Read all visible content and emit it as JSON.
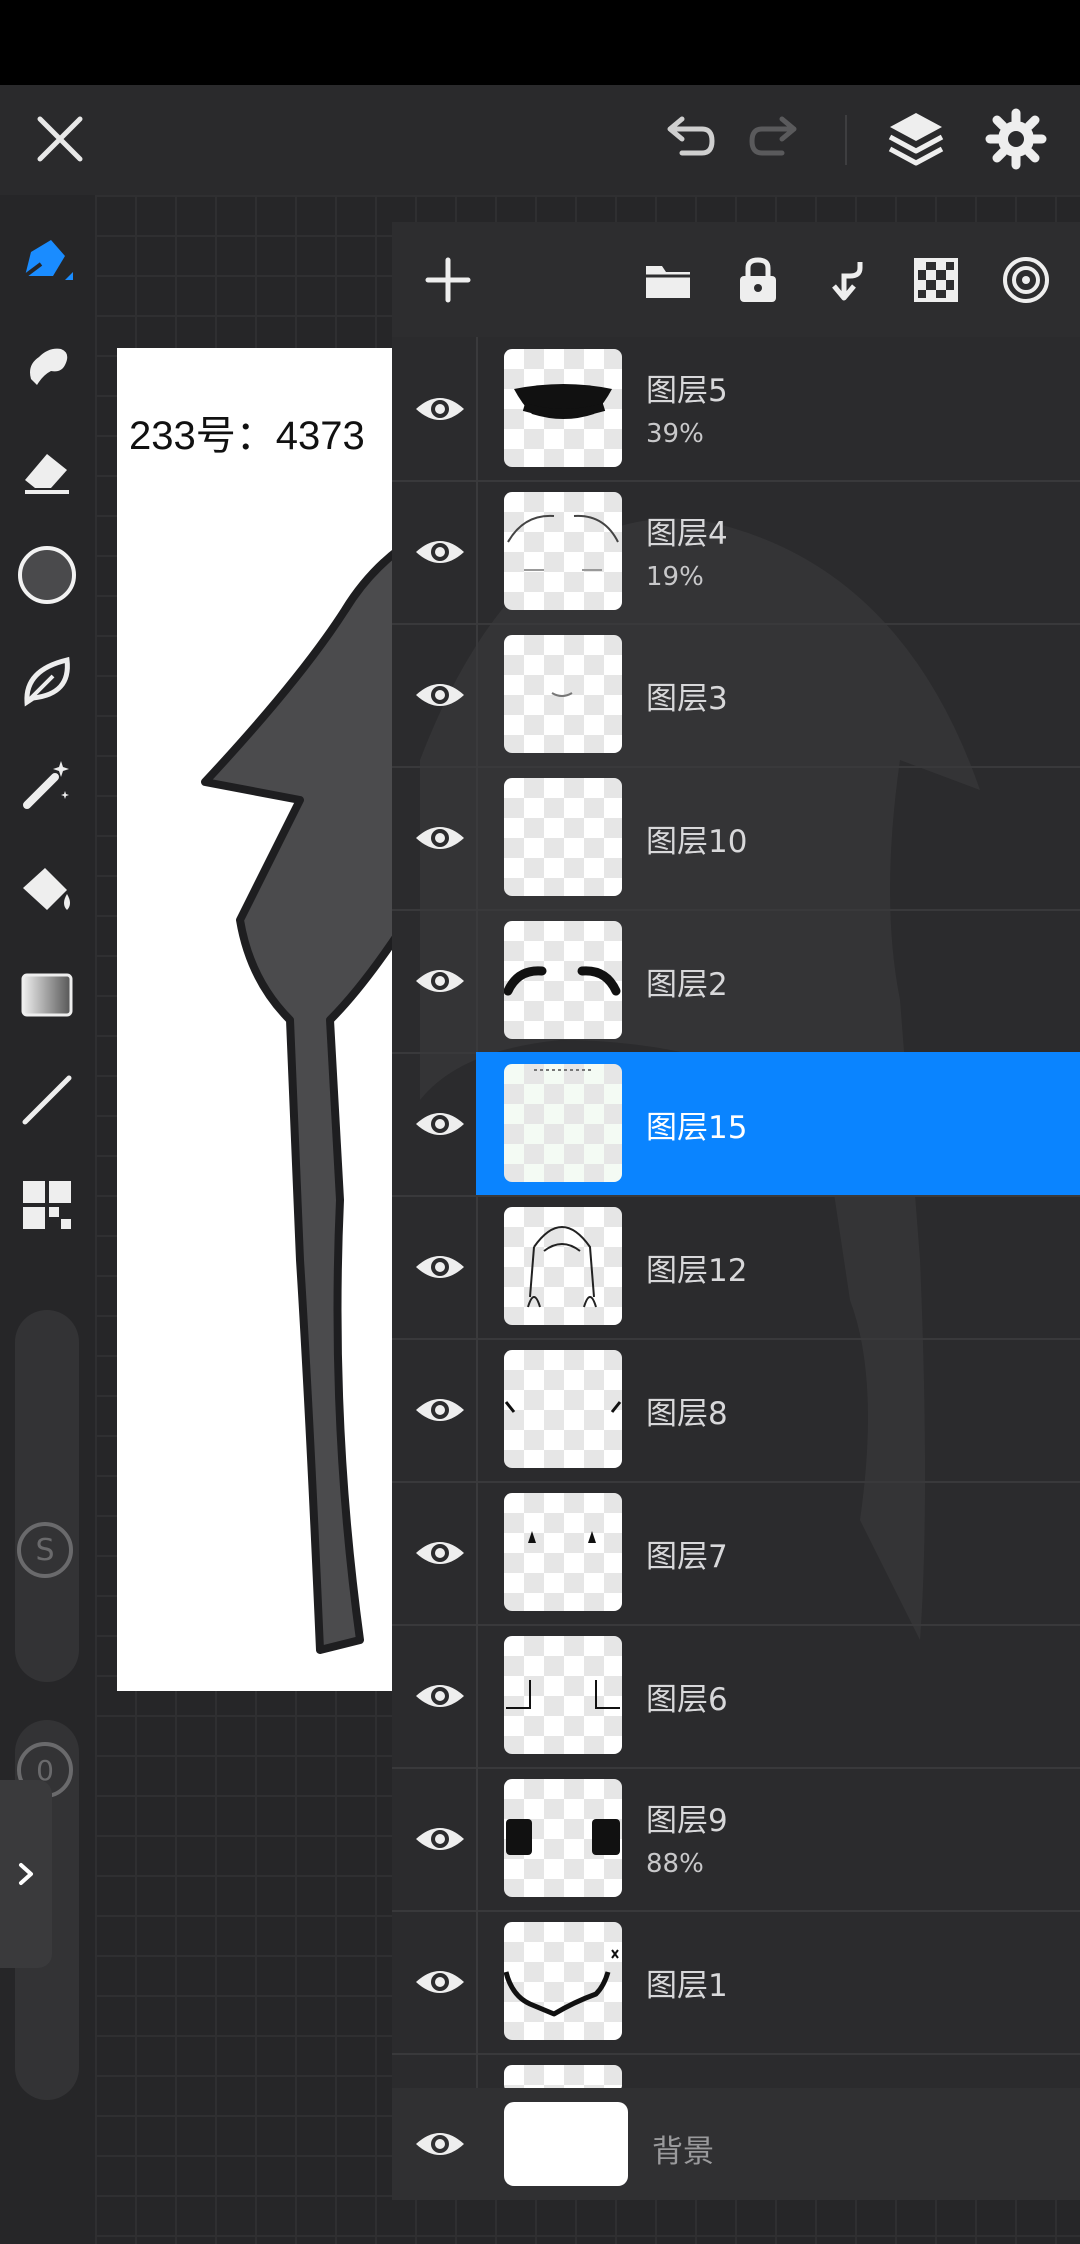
{
  "topbar": {
    "close_icon": "close-icon",
    "undo_icon": "undo-icon",
    "redo_icon": "redo-icon",
    "layers_icon": "layers-icon",
    "settings_icon": "gear-icon"
  },
  "toolbar": {
    "tools": [
      "pen-tool-icon",
      "smudge-icon",
      "eraser-icon",
      "color-swatch",
      "leaf-brush-icon",
      "magic-wand-icon",
      "fill-bucket-icon",
      "gradient-icon",
      "line-icon",
      "grid-panel-icon"
    ],
    "brush_size_label": "S",
    "opacity_value": "0",
    "expand_tab_icon": "chevron-right-icon",
    "color_swatch": "#4a4a4c"
  },
  "canvas": {
    "paper_text": "233号：4373"
  },
  "layers_panel": {
    "header_icons": [
      "plus-icon",
      "folder-icon",
      "lock-icon",
      "merge-down-icon",
      "checkerboard-icon",
      "target-icon"
    ],
    "layers": [
      {
        "name": "图层5",
        "opacity": "39%"
      },
      {
        "name": "图层4",
        "opacity": "19%"
      },
      {
        "name": "图层3",
        "opacity": ""
      },
      {
        "name": "图层10",
        "opacity": ""
      },
      {
        "name": "图层2",
        "opacity": ""
      },
      {
        "name": "图层15",
        "opacity": "",
        "selected": true
      },
      {
        "name": "图层12",
        "opacity": ""
      },
      {
        "name": "图层8",
        "opacity": ""
      },
      {
        "name": "图层7",
        "opacity": ""
      },
      {
        "name": "图层6",
        "opacity": ""
      },
      {
        "name": "图层9",
        "opacity": "88%"
      },
      {
        "name": "图层1",
        "opacity": ""
      }
    ],
    "background_layer": {
      "name": "背景"
    },
    "accent_color": "#0a84ff"
  }
}
